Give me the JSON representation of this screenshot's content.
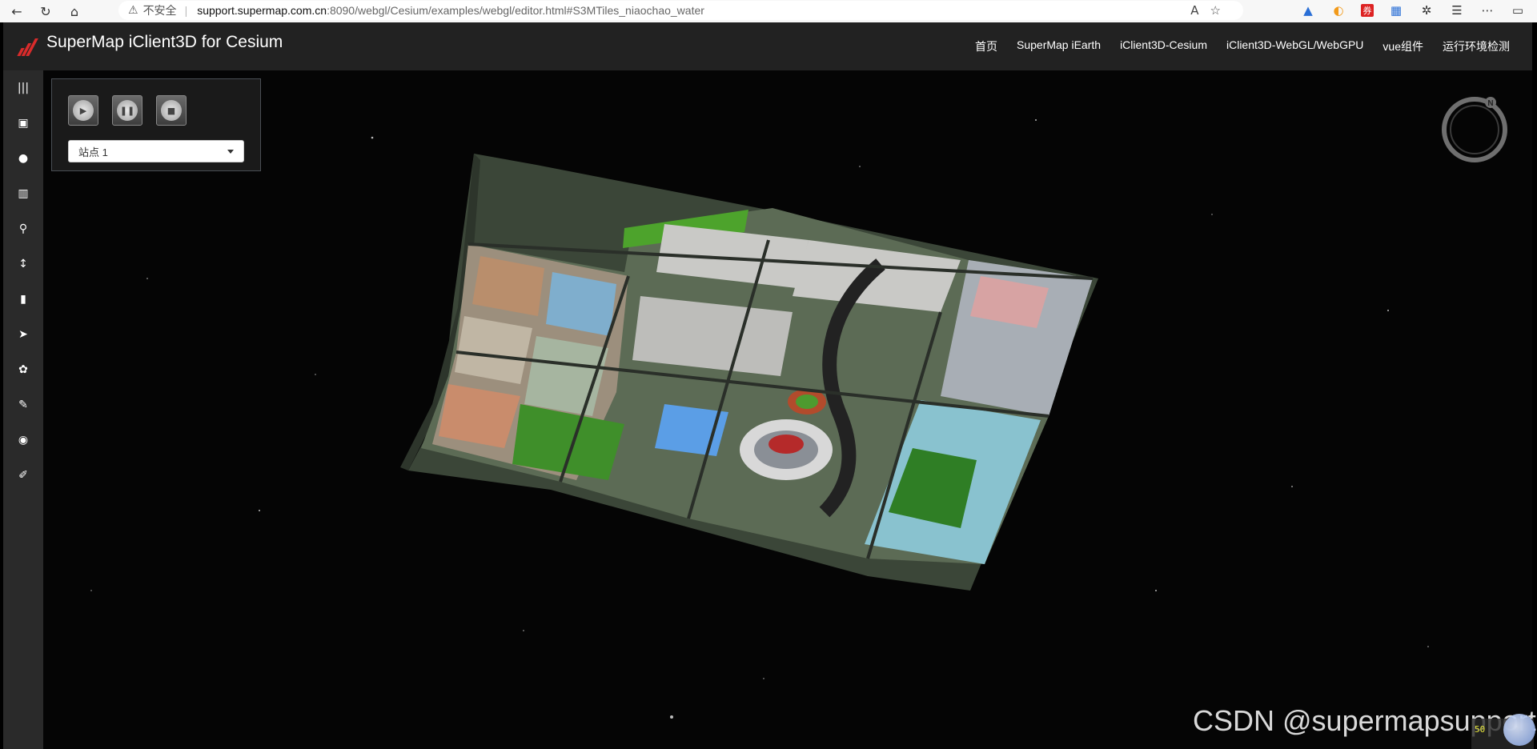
{
  "browser": {
    "back_icon": "arrow-left-icon",
    "insecure_label": "不安全",
    "url_host": "support.supermap.com.cn",
    "url_path": ":8090/webgl/Cesium/examples/webgl/editor.html#S3MTiles_niaochao_water"
  },
  "app": {
    "title": "SuperMap iClient3D for Cesium",
    "brand_color": "#d92b2b",
    "nav": [
      "首页",
      "SuperMap iEarth",
      "iClient3D-Cesium",
      "iClient3D-WebGL/WebGPU",
      "vue组件",
      "运行环境检测"
    ]
  },
  "sidebar": {
    "items": [
      "menu-icon",
      "layers-icon",
      "globe-icon",
      "bank-icon",
      "search-icon",
      "height-icon",
      "map-icon",
      "send-icon",
      "cubes-icon",
      "edit-icon",
      "eye-icon",
      "pencil-icon"
    ]
  },
  "panel": {
    "play_icon": "play-icon",
    "pause_icon": "pause-icon",
    "stop_icon": "stop-icon",
    "selected_site": "站点 1"
  },
  "compass": {
    "north_label": "N"
  },
  "watermark": "CSDN @supermapsupport",
  "fps_label": "50"
}
